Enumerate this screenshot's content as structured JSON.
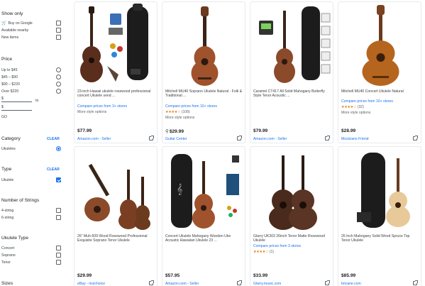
{
  "sidebar": {
    "show_only": {
      "title": "Show only",
      "buy_on_google": "Buy on Google",
      "available_nearby": "Available nearby",
      "new_items": "New items"
    },
    "price": {
      "title": "Price",
      "options": [
        "Up to $45",
        "$45 – $90",
        "$90 – $220",
        "Over $220"
      ],
      "min_value": "$",
      "to": "to",
      "max_value": "$",
      "go": "GO"
    },
    "category": {
      "title": "Category",
      "clear": "CLEAR",
      "option": "Ukuleles"
    },
    "type": {
      "title": "Type",
      "clear": "CLEAR",
      "option": "Ukulele"
    },
    "strings": {
      "title": "Number of Strings",
      "options": [
        "4-string",
        "6-string"
      ]
    },
    "ukulele_type": {
      "title": "Ukulele Type",
      "options": [
        "Concert",
        "Soprano",
        "Tenor"
      ]
    },
    "sizes": {
      "title": "Sizes"
    }
  },
  "products": [
    {
      "title": "23-inch Hawaii ukulele rosewood professional concert Ukulele send ...",
      "compare": "Compare prices from 3+ stores",
      "rating_stars": "",
      "rating_count": "",
      "more": "More style options",
      "price": "$77.99",
      "has_pin": false,
      "seller": "Amazon.com - Seller"
    },
    {
      "title": "Mitchell MU40 Soprano Ukulele Natural - Folk & Traditional ...",
      "compare": "Compare prices from 10+ stores",
      "rating_stars": "★★★★☆",
      "rating_count": "(108)",
      "more": "More style options",
      "price": "$29.99",
      "has_pin": true,
      "seller": "Guitar Center"
    },
    {
      "title": "Caramel CT417 All Solid Mahogany Butterfly Style Tenor Acoustic ...",
      "compare": "",
      "rating_stars": "",
      "rating_count": "",
      "more": "",
      "price": "$79.99",
      "has_pin": false,
      "seller": "Amazon.com - Seller"
    },
    {
      "title": "Mitchell MU40 Concert Ukulele Natural",
      "compare": "Compare prices from 10+ stores",
      "rating_stars": "★★★★☆",
      "rating_count": "(32)",
      "more": "More style options",
      "price": "$28.99",
      "has_pin": false,
      "seller": "Musicians Friend"
    },
    {
      "title": "26\" Muh-509 Wood Rosewood Professional Exquisite Soprano Tenor Ukulele",
      "compare": "",
      "rating_stars": "",
      "rating_count": "",
      "more": "",
      "price": "$29.99",
      "has_pin": false,
      "seller": "eBay - mulchoice"
    },
    {
      "title": "Concert Ukulele Mahogany Wooden Uke Acoustic Hawaiian Ukulele 23 ...",
      "compare": "",
      "rating_stars": "",
      "rating_count": "",
      "more": "",
      "price": "$57.95",
      "has_pin": false,
      "seller": "Amazon.com - Seller"
    },
    {
      "title": "Glarry UK303 26inch Tenor Matte Rosewood Ukulele",
      "compare": "Compare prices from 3 stores",
      "rating_stars": "★★★★☆",
      "rating_count": "(1)",
      "more": "",
      "price": "$33.99",
      "has_pin": false,
      "seller": "Glarry.music.com"
    },
    {
      "title": "26 Inch Mahogany Solid Wood Spruce Top Tenor Ukulele",
      "compare": "",
      "rating_stars": "",
      "rating_count": "",
      "more": "",
      "price": "$85.99",
      "has_pin": false,
      "seller": "bricane.com"
    }
  ],
  "colors": {
    "link": "#1a73e8",
    "star": "#e37400",
    "mahogany": "#a0522d",
    "rosewood": "#5a2d1c"
  }
}
